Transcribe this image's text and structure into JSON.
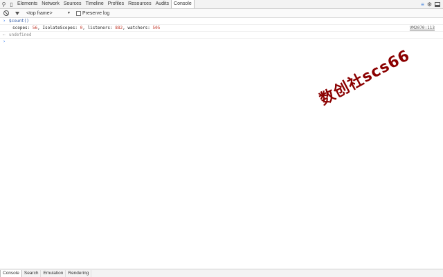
{
  "tabbar": {
    "tabs": [
      {
        "label": "Elements",
        "active": false
      },
      {
        "label": "Network",
        "active": false
      },
      {
        "label": "Sources",
        "active": false
      },
      {
        "label": "Timeline",
        "active": false
      },
      {
        "label": "Profiles",
        "active": false
      },
      {
        "label": "Resources",
        "active": false
      },
      {
        "label": "Audits",
        "active": false
      },
      {
        "label": "Console",
        "active": true
      }
    ],
    "icons": [
      "search-icon",
      "device-mode-icon",
      "show-drawer-icon",
      "settings-gear-icon",
      "dock-icon"
    ]
  },
  "toolbar": {
    "frame_selector": "<top frame>",
    "preserve_log_label": "Preserve log",
    "preserve_log_checked": false
  },
  "console": {
    "command": "$count()",
    "output": {
      "scopes_key": "scopes:",
      "scopes": "56",
      "isolate_key": "IsolateScopes:",
      "isolate": "0",
      "listeners_key": "listeners:",
      "listeners": "882",
      "watchers_key": "watchers:",
      "watchers": "505",
      "source": "VM2070:113"
    },
    "result": "undefined"
  },
  "watermark": "数创社scs66",
  "drawer": {
    "tabs": [
      {
        "label": "Console",
        "active": true
      },
      {
        "label": "Search",
        "active": false
      },
      {
        "label": "Emulation",
        "active": false
      },
      {
        "label": "Rendering",
        "active": false
      }
    ]
  },
  "colors": {
    "accent": "#367cf1",
    "number": "#c0392b",
    "watermark": "#8b0000"
  }
}
